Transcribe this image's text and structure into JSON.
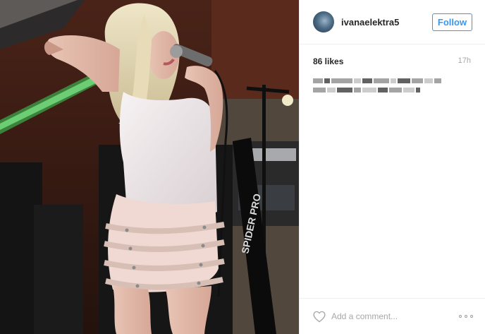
{
  "post": {
    "photo_alt": "Concert photo of a blonde performer singing into a microphone",
    "stage_text": "SPIDER PRO"
  },
  "header": {
    "username": "ivanaelektra5",
    "follow_label": "Follow"
  },
  "stats": {
    "likes": "86 likes",
    "time_ago": "17h"
  },
  "footer": {
    "comment_placeholder": "Add a comment...",
    "like_icon": "heart-icon",
    "more_icon": "more-options-icon"
  },
  "colors": {
    "accent": "#3897f0",
    "text": "#262626",
    "muted": "#a5a7aa",
    "divider": "#efefef"
  }
}
